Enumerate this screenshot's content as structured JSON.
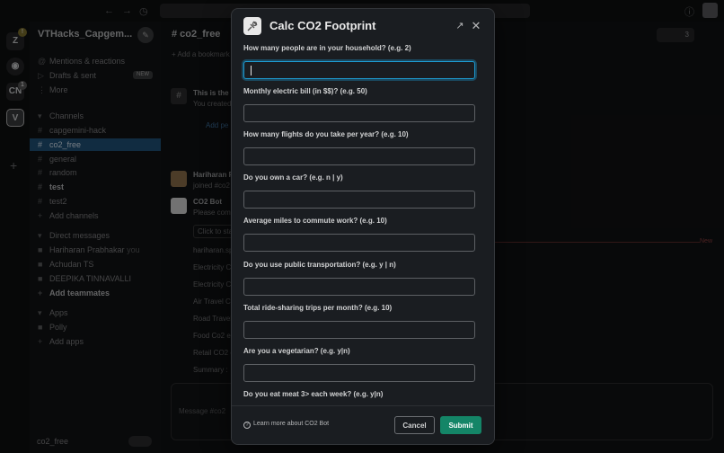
{
  "workspace": {
    "name": "VTHacks_Capgem...",
    "rail": [
      "V"
    ]
  },
  "sidebar": {
    "top_items": [
      {
        "label": "Mentions & reactions",
        "icon": "at-icon"
      },
      {
        "label": "Drafts & sent",
        "icon": "send-icon",
        "tag": "NEW"
      },
      {
        "label": "More",
        "icon": "more-icon"
      }
    ],
    "channels_header": "Channels",
    "channels": [
      {
        "label": "capgemini-hack",
        "active": false,
        "bold": false
      },
      {
        "label": "co2_free",
        "active": true,
        "bold": false
      },
      {
        "label": "general",
        "active": false,
        "bold": false
      },
      {
        "label": "random",
        "active": false,
        "bold": false
      },
      {
        "label": "test",
        "active": false,
        "bold": true
      },
      {
        "label": "test2",
        "active": false,
        "bold": false
      }
    ],
    "add_channels": "Add channels",
    "dm_header": "Direct messages",
    "dms": [
      {
        "label": "Hariharan Prabhakar",
        "suffix": "you"
      },
      {
        "label": "Achudan TS",
        "suffix": ""
      },
      {
        "label": "DEEPIKA TINNAVALLI",
        "suffix": ""
      }
    ],
    "add_teammates": "Add teammates",
    "apps_header": "Apps",
    "apps": [
      {
        "label": "Polly"
      }
    ],
    "add_apps": "Add apps",
    "footer": "co2_free"
  },
  "channel": {
    "name": "# co2_free",
    "add_bookmark": "+ Add a bookmark",
    "member_count": "3",
    "intro_title": "This is the v",
    "intro_sub": "You created",
    "add_people": "Add pe",
    "messages": [
      {
        "author": "Hariharan F",
        "text": "joined #co2"
      },
      {
        "author": "CO2 Bot",
        "text": "Please com"
      }
    ],
    "button_stub": "Click to sta",
    "lines": [
      "hariharan.sp",
      "Electricity C",
      "Electricity C",
      "Air Travel C",
      "Road Travel",
      "Food Co2 e",
      "Retail CO2 e",
      "Summary : "
    ],
    "new_label": "New",
    "composer_placeholder": "Message #co2"
  },
  "modal": {
    "title": "Calc CO2 Footprint",
    "fields": [
      {
        "label": "How many people are in your household? (e.g. 2)",
        "value": "",
        "placeholder": ""
      },
      {
        "label": "Monthly electric bill (in $$)? (e.g. 50)",
        "value": "",
        "placeholder": ""
      },
      {
        "label": "How many flights do you take per year? (e.g. 10)",
        "value": "",
        "placeholder": ""
      },
      {
        "label": "Do you own a car? (e.g. n | y)",
        "value": "",
        "placeholder": ""
      },
      {
        "label": "Average miles to commute work? (e.g. 10)",
        "value": "",
        "placeholder": ""
      },
      {
        "label": "Do you use public transportation? (e.g. y | n)",
        "value": "",
        "placeholder": ""
      },
      {
        "label": "Total ride-sharing trips per month? (e.g. 10)",
        "value": "",
        "placeholder": ""
      },
      {
        "label": "Are you a vegetarian? (e.g. y|n)",
        "value": "",
        "placeholder": ""
      },
      {
        "label": "Do you eat meat 3> each week? (e.g. y|n)",
        "value": "",
        "placeholder": ""
      }
    ],
    "learn_more": "Learn more about CO2 Bot",
    "cancel_label": "Cancel",
    "submit_label": "Submit"
  },
  "colors": {
    "submit": "#148567",
    "focus": "#1d9bd1",
    "active_channel": "#1f5077"
  }
}
